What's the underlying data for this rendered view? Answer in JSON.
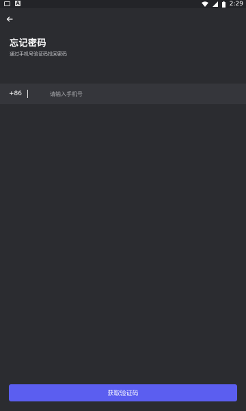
{
  "status_bar": {
    "time": "2:29",
    "a_icon": "A",
    "icons": [
      "message-icon",
      "a-notification-icon",
      "wifi-icon",
      "signal-icon",
      "battery-icon"
    ]
  },
  "header": {
    "back_icon": "back-arrow-icon",
    "title": "忘记密码",
    "subtitle": "通过手机号验证码找回密码"
  },
  "form": {
    "country_code": "+86",
    "phone_placeholder": "请输入手机号",
    "phone_value": ""
  },
  "actions": {
    "submit_label": "获取验证码"
  },
  "colors": {
    "background": "#2b2c30",
    "input_row": "#35363b",
    "accent": "#5b5ef0"
  }
}
